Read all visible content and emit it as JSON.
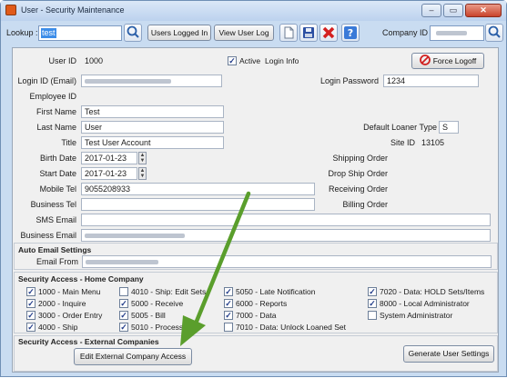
{
  "window": {
    "title": "User - Security Maintenance",
    "minimize": "–",
    "maximize": "▭",
    "close": "✕"
  },
  "toolbar": {
    "lookup_label": "Lookup :",
    "lookup_value": "test",
    "users_logged_in": "Users Logged In",
    "view_user_log": "View User Log",
    "company_id_label": "Company ID"
  },
  "form": {
    "user_id_label": "User ID",
    "user_id": "1000",
    "active_label": "Active",
    "active_checked": true,
    "login_info_label": "Login Info",
    "force_logoff": "Force Logoff",
    "login_id_label": "Login ID (Email)",
    "login_password_label": "Login Password",
    "login_password": "1234",
    "employee_id_label": "Employee ID",
    "first_name_label": "First Name",
    "first_name": "Test",
    "last_name_label": "Last Name",
    "last_name": "User",
    "default_loaner_type_label": "Default Loaner Type",
    "default_loaner_type": "S",
    "title_label": "Title",
    "title": "Test User Account",
    "site_id_label": "Site ID",
    "site_id": "13105",
    "birth_date_label": "Birth Date",
    "birth_date": "2017-01-23",
    "shipping_order_label": "Shipping Order",
    "start_date_label": "Start Date",
    "start_date": "2017-01-23",
    "drop_ship_order_label": "Drop Ship Order",
    "mobile_tel_label": "Mobile Tel",
    "mobile_tel": "9055208933",
    "receiving_order_label": "Receiving Order",
    "business_tel_label": "Business Tel",
    "billing_order_label": "Billing Order",
    "sms_email_label": "SMS Email",
    "business_email_label": "Business Email"
  },
  "auto_email": {
    "title": "Auto Email Settings",
    "email_from_label": "Email From"
  },
  "security_home": {
    "title": "Security Access - Home Company",
    "col1": [
      {
        "label": "1000 - Main Menu",
        "checked": true
      },
      {
        "label": "2000 - Inquire",
        "checked": true
      },
      {
        "label": "3000 - Order Entry",
        "checked": true
      },
      {
        "label": "4000 - Ship",
        "checked": true
      }
    ],
    "col2": [
      {
        "label": "4010 - Ship: Edit Sets",
        "checked": false
      },
      {
        "label": "5000 - Receive",
        "checked": true
      },
      {
        "label": "5005 - Bill",
        "checked": true
      },
      {
        "label": "5010 - Process",
        "checked": true
      }
    ],
    "col3": [
      {
        "label": "5050 - Late Notification",
        "checked": true
      },
      {
        "label": "6000 - Reports",
        "checked": true
      },
      {
        "label": "7000 - Data",
        "checked": true
      },
      {
        "label": "7010 - Data: Unlock Loaned Set",
        "checked": false
      }
    ],
    "col4": [
      {
        "label": "7020 - Data:  HOLD Sets/Items",
        "checked": true
      },
      {
        "label": "8000 - Local Administrator",
        "checked": true
      },
      {
        "label": "System Administrator",
        "checked": false
      }
    ]
  },
  "security_external": {
    "title": "Security Access - External Companies",
    "edit_button": "Edit External Company Access",
    "generate_button": "Generate User Settings"
  },
  "colors": {
    "arrow": "#5a9e2c",
    "title_bar": "#c9dcf1",
    "selection": "#3d8de8"
  }
}
